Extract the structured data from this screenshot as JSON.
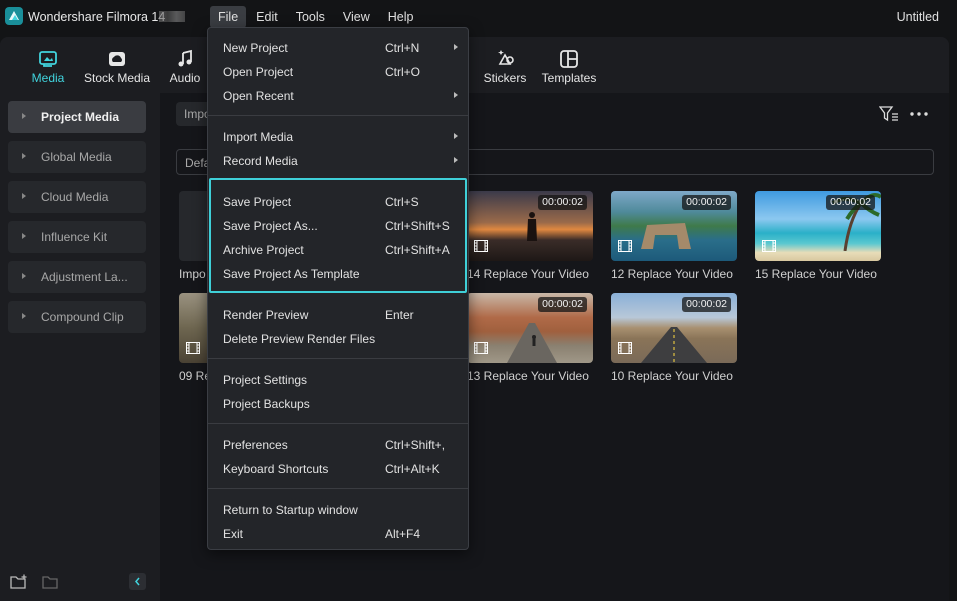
{
  "app": {
    "name": "Wondershare Filmora 14",
    "window_title": "Untitled",
    "accent_color": "#41d4de",
    "highlight_color": "#3fd0d8"
  },
  "menubar": [
    {
      "label": "File",
      "active": true
    },
    {
      "label": "Edit"
    },
    {
      "label": "Tools"
    },
    {
      "label": "View"
    },
    {
      "label": "Help"
    }
  ],
  "toolbar": [
    {
      "label": "Media",
      "icon": "media-icon",
      "active": true
    },
    {
      "label": "Stock Media",
      "icon": "stock-media-icon"
    },
    {
      "label": "Audio",
      "icon": "music-note-icon"
    },
    {
      "label": "Stickers",
      "icon": "stickers-icon"
    },
    {
      "label": "Templates",
      "icon": "templates-icon"
    }
  ],
  "sidebar": {
    "items": [
      {
        "label": "Project Media",
        "active": true
      },
      {
        "label": "Global Media"
      },
      {
        "label": "Cloud Media"
      },
      {
        "label": "Influence Kit"
      },
      {
        "label": "Adjustment La..."
      },
      {
        "label": "Compound Clip"
      }
    ]
  },
  "content": {
    "import_label": "Import",
    "search_prefix": "Default",
    "first_card_label": "Impo",
    "media": [
      {
        "label": "14 Replace Your Video",
        "duration": "00:00:02"
      },
      {
        "label": "12 Replace Your Video",
        "duration": "00:00:02"
      },
      {
        "label": "15 Replace Your Video",
        "duration": "00:00:02"
      },
      {
        "label": "09 Re",
        "duration": ""
      },
      {
        "label": "13 Replace Your Video",
        "duration": "00:00:02"
      },
      {
        "label": "10 Replace Your Video",
        "duration": "00:00:02"
      }
    ]
  },
  "file_menu": {
    "groups": [
      [
        {
          "label": "New Project",
          "shortcut": "Ctrl+N",
          "submenu": true
        },
        {
          "label": "Open Project",
          "shortcut": "Ctrl+O"
        },
        {
          "label": "Open Recent",
          "shortcut": "",
          "submenu": true
        }
      ],
      [
        {
          "label": "Import Media",
          "shortcut": "",
          "submenu": true
        },
        {
          "label": "Record Media",
          "shortcut": "",
          "submenu": true
        }
      ],
      [
        {
          "label": "Save Project",
          "shortcut": "Ctrl+S"
        },
        {
          "label": "Save Project As...",
          "shortcut": "Ctrl+Shift+S"
        },
        {
          "label": "Archive Project",
          "shortcut": "Ctrl+Shift+A"
        },
        {
          "label": "Save Project As Template",
          "shortcut": ""
        }
      ],
      [
        {
          "label": "Render Preview",
          "shortcut": "Enter"
        },
        {
          "label": "Delete Preview Render Files",
          "shortcut": ""
        }
      ],
      [
        {
          "label": "Project Settings",
          "shortcut": ""
        },
        {
          "label": "Project Backups",
          "shortcut": ""
        }
      ],
      [
        {
          "label": "Preferences",
          "shortcut": "Ctrl+Shift+,"
        },
        {
          "label": "Keyboard Shortcuts",
          "shortcut": "Ctrl+Alt+K"
        }
      ],
      [
        {
          "label": "Return to Startup window",
          "shortcut": ""
        },
        {
          "label": "Exit",
          "shortcut": "Alt+F4"
        }
      ]
    ]
  }
}
